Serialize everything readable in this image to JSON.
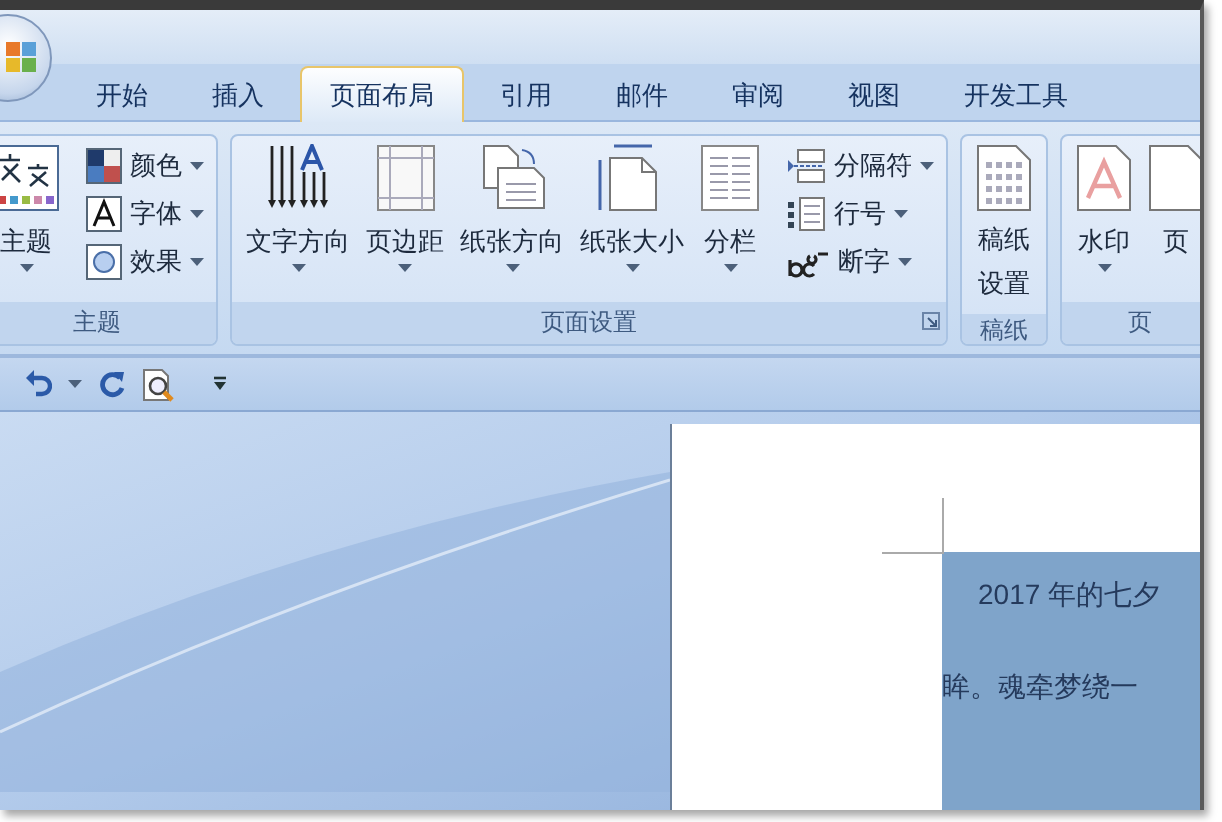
{
  "tabs": [
    {
      "label": "开始",
      "selected": false
    },
    {
      "label": "插入",
      "selected": false
    },
    {
      "label": "页面布局",
      "selected": true
    },
    {
      "label": "引用",
      "selected": false
    },
    {
      "label": "邮件",
      "selected": false
    },
    {
      "label": "审阅",
      "selected": false
    },
    {
      "label": "视图",
      "selected": false
    },
    {
      "label": "开发工具",
      "selected": false
    }
  ],
  "ribbon": {
    "groups": [
      {
        "label": "主题",
        "launcher": false,
        "large": [
          {
            "label": "主题",
            "dropdown": true
          }
        ],
        "small": [
          {
            "label": "颜色",
            "dropdown": true
          },
          {
            "label": "字体",
            "dropdown": true
          },
          {
            "label": "效果",
            "dropdown": true
          }
        ]
      },
      {
        "label": "页面设置",
        "launcher": true,
        "large": [
          {
            "label": "文字方向",
            "dropdown": true
          },
          {
            "label": "页边距",
            "dropdown": true
          },
          {
            "label": "纸张方向",
            "dropdown": true
          },
          {
            "label": "纸张大小",
            "dropdown": true
          },
          {
            "label": "分栏",
            "dropdown": true
          }
        ],
        "small": [
          {
            "label": "分隔符",
            "dropdown": true
          },
          {
            "label": "行号",
            "dropdown": true
          },
          {
            "label": "断字",
            "dropdown": true
          }
        ]
      },
      {
        "label": "稿纸",
        "launcher": false,
        "large": [
          {
            "label": "稿纸设置",
            "dropdown": false
          }
        ]
      },
      {
        "label": "页",
        "launcher": false,
        "large": [
          {
            "label": "水印",
            "dropdown": true
          },
          {
            "label": "页",
            "dropdown": false
          }
        ]
      }
    ]
  },
  "document": {
    "lines": [
      "2017 年的七夕",
      "眸。魂牵梦绕一"
    ]
  }
}
